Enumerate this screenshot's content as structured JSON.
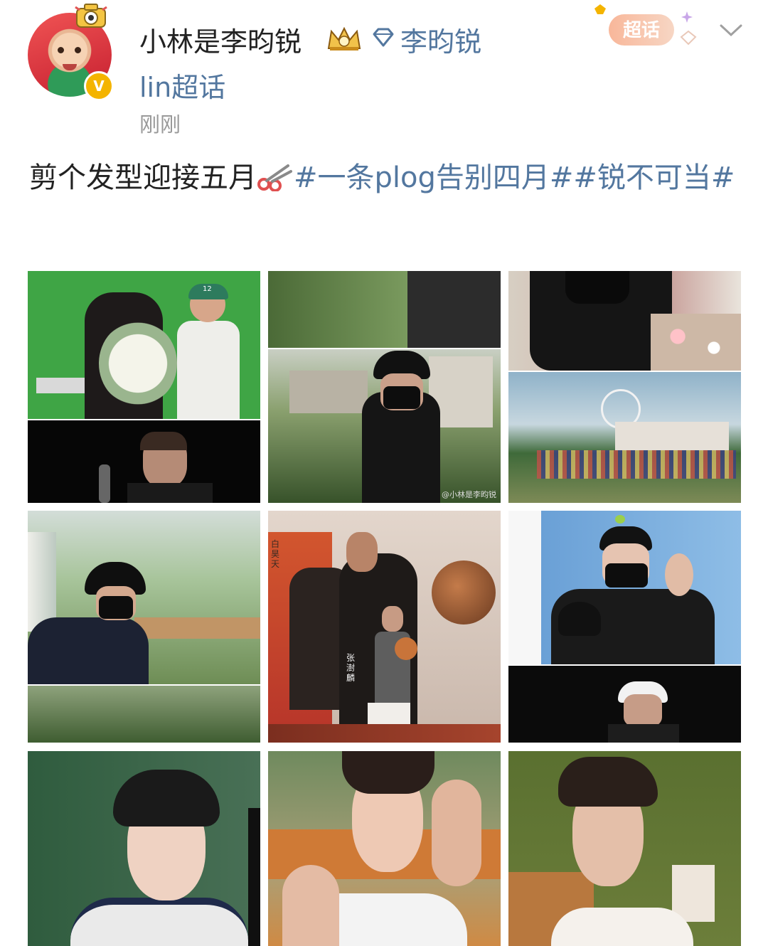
{
  "post": {
    "author_name": "小林是李昀锐",
    "topic_link": "李昀锐",
    "supertopic_line": "lin超话",
    "timestamp": "刚刚",
    "badge_label": "超话",
    "text_plain": "剪个发型迎接五月",
    "hashtag_1": "#一条plog告别四月#",
    "hashtag_2": "#锐不可当#"
  },
  "photos": [
    {
      "name": "photo-1",
      "labels": {
        "cap": "12"
      }
    },
    {
      "name": "photo-2",
      "watermark": "@小林是李昀锐"
    },
    {
      "name": "photo-3"
    },
    {
      "name": "photo-4"
    },
    {
      "name": "photo-5"
    },
    {
      "name": "photo-6",
      "labels": {
        "left": "白昊天",
        "mid": "张澍麟"
      }
    },
    {
      "name": "photo-7"
    },
    {
      "name": "photo-8"
    },
    {
      "name": "photo-9"
    }
  ],
  "colors": {
    "link": "#53779f",
    "name": "#222222",
    "meta": "#999999",
    "badge": "#f4b400"
  }
}
